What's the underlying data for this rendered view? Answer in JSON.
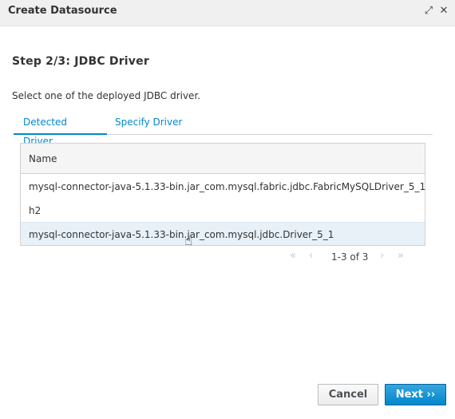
{
  "dialog": {
    "title": "Create Datasource",
    "maximize_glyph": "⤢",
    "close_glyph": "✕"
  },
  "step": {
    "heading": "Step 2/3: JDBC Driver",
    "instruction": "Select one of the deployed JDBC driver."
  },
  "tabs": [
    {
      "label": "Detected Driver",
      "active": true
    },
    {
      "label": "Specify Driver",
      "active": false
    }
  ],
  "grid": {
    "column": "Name",
    "rows": [
      "mysql-connector-java-5.1.33-bin.jar_com.mysql.fabric.jdbc.FabricMySQLDriver_5_1",
      "h2",
      "mysql-connector-java-5.1.33-bin.jar_com.mysql.jdbc.Driver_5_1"
    ],
    "selected_row": 2
  },
  "pager": {
    "first": "«",
    "prev": "‹",
    "info": "1-3 of 3",
    "next": "›",
    "last": "»"
  },
  "cursor_glyph": "☝",
  "buttons": {
    "cancel": "Cancel",
    "next": "Next ››"
  },
  "colors": {
    "accent": "#0088ce",
    "selected_row": "#e8f1f8",
    "primary_button": "#0088ce"
  }
}
